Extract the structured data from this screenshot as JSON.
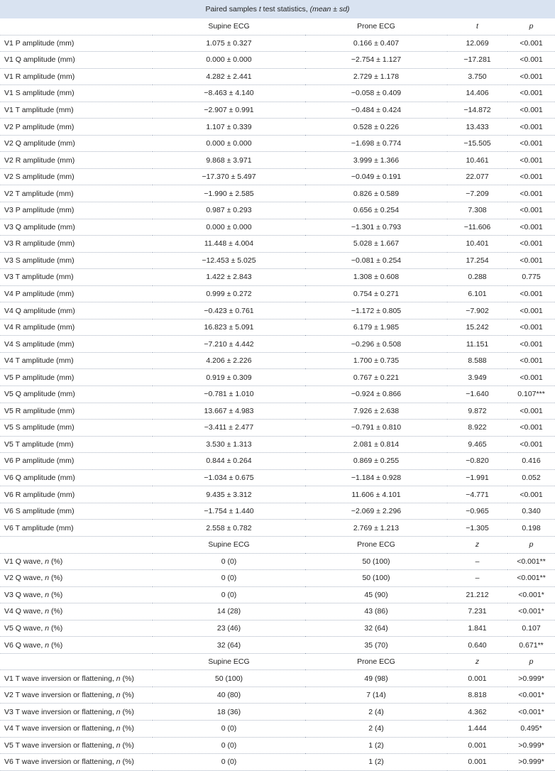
{
  "title": {
    "pre": "Paired samples ",
    "t": "t",
    "post": " test statistics, ",
    "suffix": "(mean ± sd)"
  },
  "section1": {
    "header": [
      "",
      "Supine ECG",
      "Prone ECG",
      "t",
      "p"
    ],
    "rows": [
      [
        "V1 P amplitude (mm)",
        "1.075 ± 0.327",
        "0.166 ± 0.407",
        "12.069",
        "<0.001"
      ],
      [
        "V1 Q amplitude (mm)",
        "0.000 ± 0.000",
        "−2.754 ± 1.127",
        "−17.281",
        "<0.001"
      ],
      [
        "V1 R amplitude (mm)",
        "4.282 ± 2.441",
        "2.729 ± 1.178",
        "3.750",
        "<0.001"
      ],
      [
        "V1 S amplitude (mm)",
        "−8.463 ± 4.140",
        "−0.058 ± 0.409",
        "14.406",
        "<0.001"
      ],
      [
        "V1 T amplitude (mm)",
        "−2.907 ± 0.991",
        "−0.484 ± 0.424",
        "−14.872",
        "<0.001"
      ],
      [
        "V2 P amplitude (mm)",
        "1.107 ± 0.339",
        "0.528 ± 0.226",
        "13.433",
        "<0.001"
      ],
      [
        "V2 Q amplitude (mm)",
        "0.000 ± 0.000",
        "−1.698 ± 0.774",
        "−15.505",
        "<0.001"
      ],
      [
        "V2 R amplitude (mm)",
        "9.868 ± 3.971",
        "3.999 ± 1.366",
        "10.461",
        "<0.001"
      ],
      [
        "V2 S amplitude (mm)",
        "−17.370 ± 5.497",
        "−0.049 ± 0.191",
        "22.077",
        "<0.001"
      ],
      [
        "V2 T amplitude (mm)",
        "−1.990 ± 2.585",
        "0.826 ± 0.589",
        "−7.209",
        "<0.001"
      ],
      [
        "V3 P amplitude (mm)",
        "0.987 ± 0.293",
        "0.656 ± 0.254",
        "7.308",
        "<0.001"
      ],
      [
        "V3 Q amplitude (mm)",
        "0.000 ± 0.000",
        "−1.301 ± 0.793",
        "−11.606",
        "<0.001"
      ],
      [
        "V3 R amplitude (mm)",
        "11.448 ± 4.004",
        "5.028 ± 1.667",
        "10.401",
        "<0.001"
      ],
      [
        "V3 S amplitude (mm)",
        "−12.453 ± 5.025",
        "−0.081 ± 0.254",
        "17.254",
        "<0.001"
      ],
      [
        "V3 T amplitude (mm)",
        "1.422 ± 2.843",
        "1.308 ± 0.608",
        "0.288",
        "0.775"
      ],
      [
        "V4 P amplitude (mm)",
        "0.999 ± 0.272",
        "0.754 ± 0.271",
        "6.101",
        "<0.001"
      ],
      [
        "V4 Q amplitude (mm)",
        "−0.423 ± 0.761",
        "−1.172 ± 0.805",
        "−7.902",
        "<0.001"
      ],
      [
        "V4 R amplitude (mm)",
        "16.823 ± 5.091",
        "6.179 ± 1.985",
        "15.242",
        "<0.001"
      ],
      [
        "V4 S amplitude (mm)",
        "−7.210 ± 4.442",
        "−0.296 ± 0.508",
        "11.151",
        "<0.001"
      ],
      [
        "V4 T amplitude (mm)",
        "4.206 ± 2.226",
        "1.700 ± 0.735",
        "8.588",
        "<0.001"
      ],
      [
        "V5 P amplitude (mm)",
        "0.919 ± 0.309",
        "0.767 ± 0.221",
        "3.949",
        "<0.001"
      ],
      [
        "V5 Q amplitude (mm)",
        "−0.781 ± 1.010",
        "−0.924 ± 0.866",
        "−1.640",
        "0.107***"
      ],
      [
        "V5 R amplitude (mm)",
        "13.667 ± 4.983",
        "7.926 ± 2.638",
        "9.872",
        "<0.001"
      ],
      [
        "V5 S amplitude (mm)",
        "−3.411 ± 2.477",
        "−0.791 ± 0.810",
        "8.922",
        "<0.001"
      ],
      [
        "V5 T amplitude (mm)",
        "3.530 ± 1.313",
        "2.081 ± 0.814",
        "9.465",
        "<0.001"
      ],
      [
        "V6 P amplitude (mm)",
        "0.844 ± 0.264",
        "0.869 ± 0.255",
        "−0.820",
        "0.416"
      ],
      [
        "V6 Q amplitude (mm)",
        "−1.034 ± 0.675",
        "−1.184 ± 0.928",
        "−1.991",
        "0.052"
      ],
      [
        "V6 R amplitude (mm)",
        "9.435 ± 3.312",
        "11.606 ± 4.101",
        "−4.771",
        "<0.001"
      ],
      [
        "V6 S amplitude (mm)",
        "−1.754 ± 1.440",
        "−2.069 ± 2.296",
        "−0.965",
        "0.340"
      ],
      [
        "V6 T amplitude (mm)",
        "2.558 ± 0.782",
        "2.769 ± 1.213",
        "−1.305",
        "0.198"
      ]
    ]
  },
  "section2": {
    "header": [
      "",
      "Supine ECG",
      "Prone ECG",
      "z",
      "p"
    ],
    "rows": [
      [
        "V1 Q wave, ",
        "n",
        " (%)",
        "0 (0)",
        "50 (100)",
        "–",
        "<0.001**"
      ],
      [
        "V2 Q wave, ",
        "n",
        " (%)",
        "0 (0)",
        "50 (100)",
        "–",
        "<0.001**"
      ],
      [
        "V3 Q wave, ",
        "n",
        " (%)",
        "0 (0)",
        "45 (90)",
        "21.212",
        "<0.001*"
      ],
      [
        "V4 Q wave, ",
        "n",
        " (%)",
        "14 (28)",
        "43 (86)",
        "7.231",
        "<0.001*"
      ],
      [
        "V5 Q wave, ",
        "n",
        " (%)",
        "23 (46)",
        "32 (64)",
        "1.841",
        "0.107"
      ],
      [
        "V6 Q wave, ",
        "n",
        " (%)",
        "32 (64)",
        "35 (70)",
        "0.640",
        "0.671**"
      ]
    ]
  },
  "section3": {
    "header": [
      "",
      "Supine ECG",
      "Prone ECG",
      "z",
      "p"
    ],
    "rows": [
      [
        "V1 T wave inversion or flattening, ",
        "n",
        " (%)",
        "50 (100)",
        "49 (98)",
        "0.001",
        ">0.999*"
      ],
      [
        "V2 T wave inversion or flattening, ",
        "n",
        " (%)",
        "40 (80)",
        "7 (14)",
        "8.818",
        "<0.001*"
      ],
      [
        "V3 T wave inversion or flattening, ",
        "n",
        " (%)",
        "18 (36)",
        "2 (4)",
        "4.362",
        "<0.001*"
      ],
      [
        "V4 T wave inversion or flattening, ",
        "n",
        " (%)",
        "0 (0)",
        "2 (4)",
        "1.444",
        "0.495*"
      ],
      [
        "V5 T wave inversion or flattening, ",
        "n",
        " (%)",
        "0 (0)",
        "1 (2)",
        "0.001",
        ">0.999*"
      ],
      [
        "V6 T wave inversion or flattening, ",
        "n",
        " (%)",
        "0 (0)",
        "1 (2)",
        "0.001",
        ">0.999*"
      ]
    ]
  }
}
